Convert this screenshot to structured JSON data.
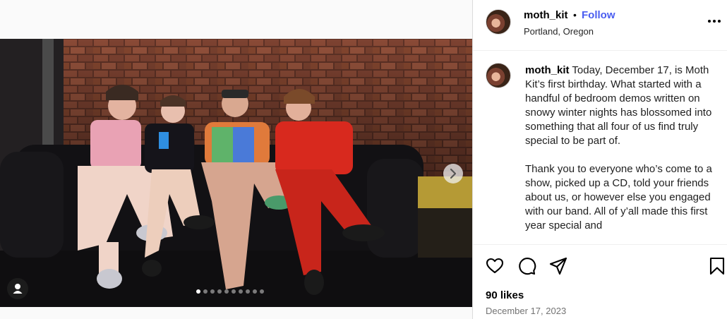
{
  "post": {
    "username": "moth_kit",
    "dot_separator": "•",
    "follow_label": "Follow",
    "location": "Portland, Oregon",
    "caption": [
      "Today, December 17, is Moth Kit’s first birthday. What started with a handful of bedroom demos written on snowy winter nights has blossomed into something that all four of us find truly special to be part of.",
      "Thank you to everyone who’s come to a show, picked up a CD, told your friends about us, or however else you engaged with our band. All of y’all made this first year special and"
    ],
    "likes": "90 likes",
    "date": "December 17, 2023"
  },
  "carousel": {
    "slides": 10,
    "active_index": 0
  },
  "icons": {
    "more": "more-options-icon",
    "like": "heart-icon",
    "comment": "comment-icon",
    "share": "share-icon",
    "save": "bookmark-icon",
    "next": "chevron-right-icon",
    "tags": "user-tag-icon"
  },
  "colors": {
    "accent": "#4a5df0",
    "secondary_text": "#737373",
    "divider": "#dbdbdb"
  }
}
